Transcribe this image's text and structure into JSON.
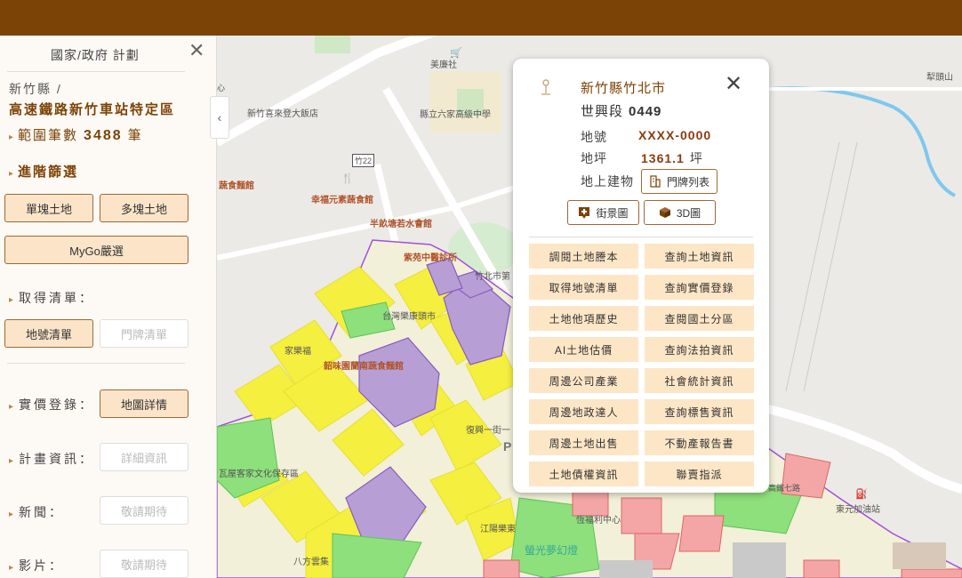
{
  "sidebar": {
    "title": "國家/政府 計劃",
    "county": "新竹縣 /",
    "district": "高速鐵路新竹車站特定區",
    "range_label": "範圍筆數",
    "range_count": "3488",
    "range_unit": "筆",
    "advanced_filter": "進階篩選",
    "single_land": "單塊土地",
    "multi_land": "多塊土地",
    "mygo": "MyGo嚴選",
    "get_list_label": "取得清單：",
    "lot_list": "地號清單",
    "door_list": "門牌清單",
    "transaction_label": "實價登錄：",
    "map_detail": "地圖詳情",
    "plan_label": "計畫資訊：",
    "plan_detail": "詳細資訊",
    "news_label": "新聞：",
    "news_pending": "敬請期待",
    "video_label": "影片：",
    "video_pending": "敬請期待"
  },
  "popup": {
    "county": "新竹縣竹北市",
    "section_name": "世興段",
    "section_no": "0449",
    "lot_key": "地號",
    "lot_val": "XXXX-0000",
    "area_key": "地坪",
    "area_val": "1361.1",
    "area_unit": "坪",
    "building_key": "地上建物",
    "door_list_btn": "門牌列表",
    "streetview_btn": "街景圖",
    "view3d_btn": "3D圖",
    "actions": [
      "調閱土地謄本",
      "查詢土地資訊",
      "取得地號清單",
      "查詢實價登錄",
      "土地他項歷史",
      "查閱國土分區",
      "AI土地估價",
      "查詢法拍資訊",
      "周邊公司產業",
      "社會統計資訊",
      "周邊地政達人",
      "查詢標售資訊",
      "周邊土地出售",
      "不動產報告書",
      "土地債權資訊",
      "聯賣指派"
    ]
  },
  "map": {
    "labels": {
      "meilianshe": "美廉社",
      "hsinchu_hotel": "新竹喜來登大飯店",
      "liujia_school": "縣立六家高級中學",
      "zhu22": "竹22",
      "noodle1": "蔬食麵館",
      "xingfu": "幸福元素蔬食館",
      "banxie": "半畝塘若水會館",
      "zijing": "紫苑中醫診所",
      "zhubei_city": "竹北市第",
      "taiwan_kang": "台灣樂康頭市",
      "jiale": "家樂福",
      "shaodong": "韶味園蘭南蔬食麵館",
      "hakka": "瓦屋客家文化保存區",
      "lightpark": "螢光夢幻燈",
      "dongyuan": "東元加油站",
      "lishan": "犁頭山",
      "gaotie": "高鐵七路",
      "fuzhong": "復興一街一",
      "jiangyang": "江陽樂東",
      "liuyu": "八方雲集",
      "hengfu": "恆福利中心"
    },
    "colors": {
      "residential": "#f5ef3f",
      "public": "#b79fd6",
      "park": "#8ee07c",
      "commercial": "#f4a6a6",
      "boundary": "#a44ee0",
      "road": "#ffffff",
      "river": "#7fc7ee"
    }
  },
  "icons": {
    "close": "close-icon",
    "chevron": "chevron-left-icon",
    "pin": "map-pin-icon",
    "building": "building-icon",
    "streetview": "streetview-icon",
    "cube": "cube-icon"
  }
}
